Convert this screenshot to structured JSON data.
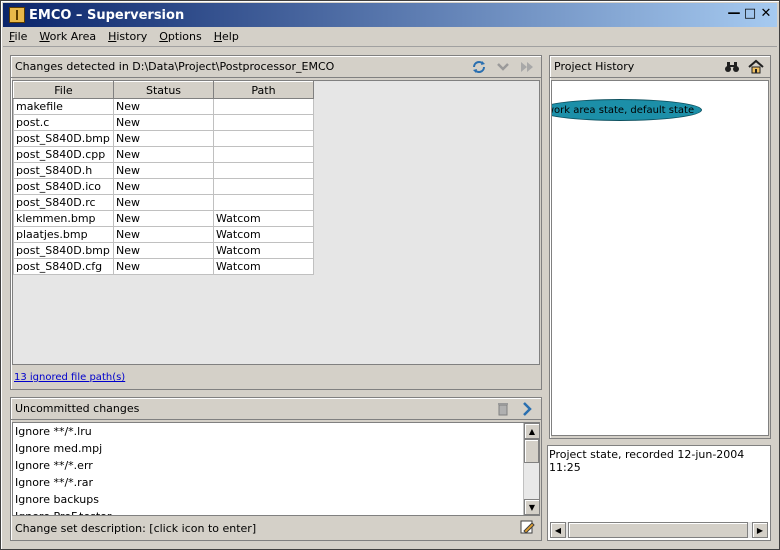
{
  "window": {
    "title": "EMCO – Superversion"
  },
  "menu": [
    {
      "u": "F",
      "rest": "ile"
    },
    {
      "u": "W",
      "rest": "ork Area"
    },
    {
      "u": "H",
      "rest": "istory"
    },
    {
      "u": "O",
      "rest": "ptions"
    },
    {
      "u": "H",
      "rest": "elp"
    }
  ],
  "changes": {
    "title": "Changes detected in D:\\Data\\Project\\Postprocessor_EMCO",
    "columns": [
      "File",
      "Status",
      "Path"
    ],
    "rows": [
      {
        "file": "makefile",
        "status": "New",
        "path": ""
      },
      {
        "file": "post.c",
        "status": "New",
        "path": ""
      },
      {
        "file": "post_S840D.bmp",
        "status": "New",
        "path": ""
      },
      {
        "file": "post_S840D.cpp",
        "status": "New",
        "path": ""
      },
      {
        "file": "post_S840D.h",
        "status": "New",
        "path": ""
      },
      {
        "file": "post_S840D.ico",
        "status": "New",
        "path": ""
      },
      {
        "file": "post_S840D.rc",
        "status": "New",
        "path": ""
      },
      {
        "file": "klemmen.bmp",
        "status": "New",
        "path": "Watcom"
      },
      {
        "file": "plaatjes.bmp",
        "status": "New",
        "path": "Watcom"
      },
      {
        "file": "post_S840D.bmp",
        "status": "New",
        "path": "Watcom"
      },
      {
        "file": "post_S840D.cfg",
        "status": "New",
        "path": "Watcom"
      }
    ],
    "ignored_link": "13 ignored file path(s)"
  },
  "uncommitted": {
    "title": "Uncommitted changes",
    "items": [
      "Ignore **/*.lru",
      "Ignore med.mpj",
      "Ignore **/*.err",
      "Ignore **/*.rar",
      "Ignore backups",
      "Ignore PreF.testor"
    ],
    "change_set_label": "Change set description: [click icon to enter]"
  },
  "history": {
    "title": "Project History",
    "node_label": "work area state, default state",
    "state_text": "Project state, recorded 12-jun-2004 11:25"
  }
}
